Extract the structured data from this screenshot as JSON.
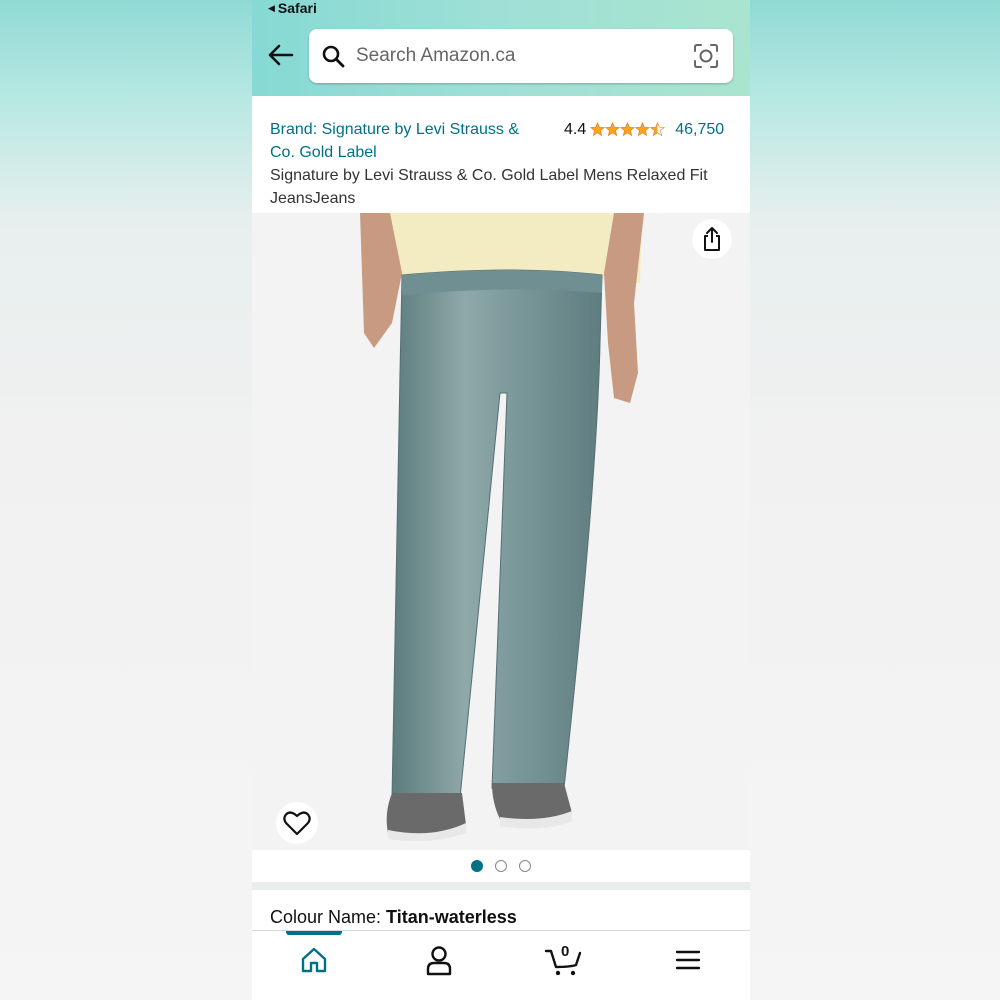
{
  "status_bar": {
    "back_app": "Safari"
  },
  "search": {
    "placeholder": "Search Amazon.ca"
  },
  "product": {
    "brand": "Brand: Signature by Levi Strauss & Co. Gold Label",
    "rating": "4.4",
    "rating_stars": 4.4,
    "review_count": "46,750",
    "title": "Signature by Levi Strauss & Co. Gold Label Mens Relaxed Fit JeansJeans"
  },
  "image_gallery": {
    "total": 3,
    "active_index": 0
  },
  "colour": {
    "label": "Colour Name: ",
    "value": "Titan-waterless"
  },
  "bottom_nav": {
    "items": [
      "home-icon",
      "account-icon",
      "cart-icon",
      "menu-icon"
    ],
    "cart_count": "0",
    "active": "home"
  },
  "colors": {
    "accent": "#007185",
    "star": "#ffa41c",
    "header_gradient_start": "#86d9d4",
    "header_gradient_end": "#a9e4cf"
  }
}
